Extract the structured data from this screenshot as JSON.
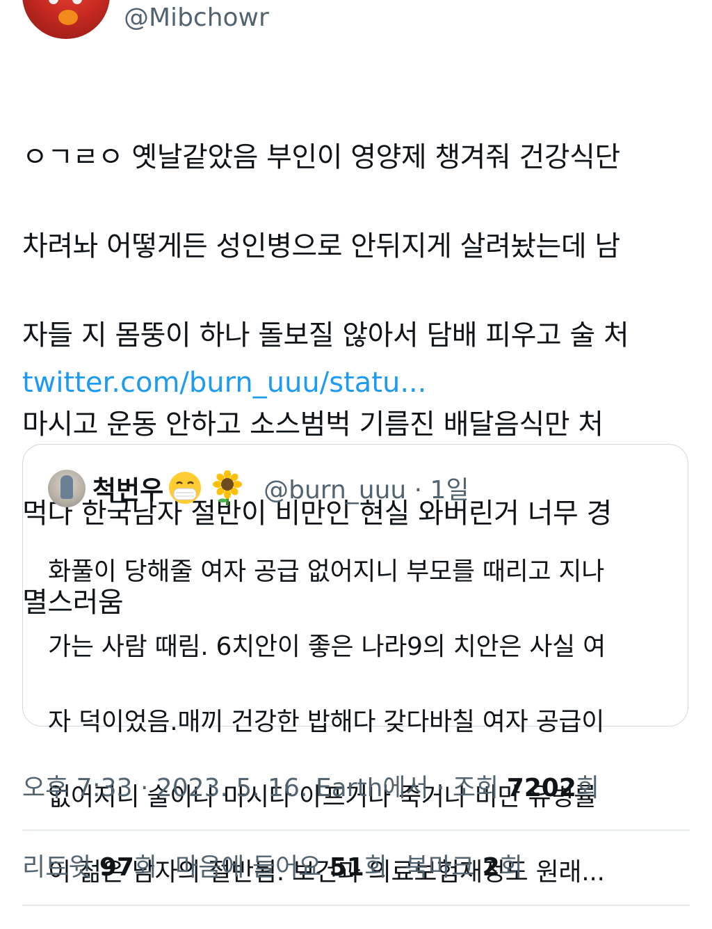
{
  "author": {
    "handle": "@Mibchowr"
  },
  "tweet": {
    "text_lines": [
      "ㅇㄱㄹㅇ 옛날같았음 부인이 영양제 챙겨줘 건강식단",
      "차려놔 어떻게든 성인병으로 안뒤지게 살려놨는데 남",
      "자들 지 몸뚱이 하나 돌보질 않아서 담배 피우고 술 처",
      "마시고 운동 안하고 소스범벅 기름진 배달음식만 처",
      "먹다 한국남자 절반이 비만인 현실 와버린거 너무 경",
      "멸스러움"
    ],
    "link": "twitter.com/burn_uuu/statu..."
  },
  "quote": {
    "name": "척번우",
    "emoji": [
      "face-with-medical-mask-icon",
      "sunflower-icon"
    ],
    "handle_time": "@burn_uuu · 1일",
    "text_lines": [
      "화풀이 당해줄 여자 공급 없어지니 부모를 때리고 지나",
      "가는 사람 때림. 6치안이 좋은 나라9의 치안은 사실 여",
      "자 덕이었음.매끼 건강한 밥해다 갖다바칠 여자 공급이",
      "없어지니 술이나 마시다 아프거나 죽거나 비만 유병률",
      "이 젊은 남자의 절반됨. 보건과 의료보험재정도 원래..."
    ]
  },
  "meta": {
    "time": "오후 7:33",
    "sep1": " · ",
    "date": "2023. 5. 16.",
    "source": " Earth에서",
    "sep2": " · ",
    "views_label": "조회 ",
    "views_count": "7202",
    "views_suffix": "회"
  },
  "stats": {
    "retweets_label": "리트윗 ",
    "retweets_count": "97",
    "retweets_suffix": "회",
    "likes_label": "마음에 들어요 ",
    "likes_count": "51",
    "likes_suffix": "회",
    "bookmarks_label": "북마크 ",
    "bookmarks_count": "2",
    "bookmarks_suffix": "회"
  },
  "colors": {
    "link": "#1d9bf0",
    "secondary_text": "#536471",
    "primary_text": "#0f1419",
    "border": "#cfd9de"
  }
}
